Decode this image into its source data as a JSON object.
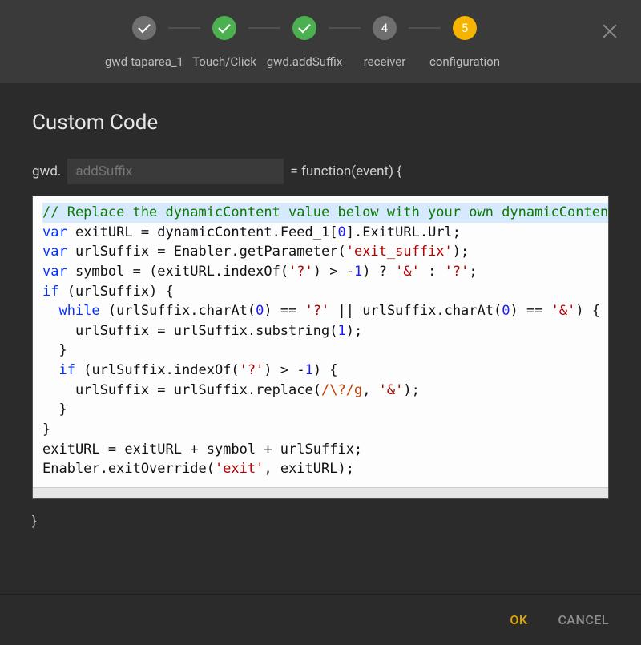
{
  "stepper": {
    "steps": [
      {
        "label": "gwd-taparea_1",
        "state": "idle-done",
        "text": ""
      },
      {
        "label": "Touch/Click",
        "state": "done",
        "text": ""
      },
      {
        "label": "gwd.addSuffix",
        "state": "done",
        "text": ""
      },
      {
        "label": "receiver",
        "state": "idle",
        "text": "4"
      },
      {
        "label": "configuration",
        "state": "active",
        "text": "5"
      }
    ]
  },
  "dialog": {
    "title": "Custom Code",
    "functionPrefix": "gwd.",
    "functionNamePlaceholder": "addSuffix",
    "functionNameValue": "addSuffix",
    "functionMid": "= function(event) {",
    "closingBrace": "}",
    "code": {
      "commentLine": "// Replace the dynamicContent value below with your own dynamicContent variable path",
      "lines": [
        "var exitURL = dynamicContent.Feed_1[0].ExitURL.Url;",
        "var urlSuffix = Enabler.getParameter('exit_suffix');",
        "var symbol = (exitURL.indexOf('?') > -1) ? '&' : '?';",
        "if (urlSuffix) {",
        "  while (urlSuffix.charAt(0) == '?' || urlSuffix.charAt(0) == '&') {",
        "    urlSuffix = urlSuffix.substring(1);",
        "  }",
        "  if (urlSuffix.indexOf('?') > -1) {",
        "    urlSuffix = urlSuffix.replace(/\\?/g, '&');",
        "  }",
        "}",
        "exitURL = exitURL + symbol + urlSuffix;",
        "Enabler.exitOverride('exit', exitURL);"
      ]
    }
  },
  "footer": {
    "ok": "OK",
    "cancel": "CANCEL"
  }
}
